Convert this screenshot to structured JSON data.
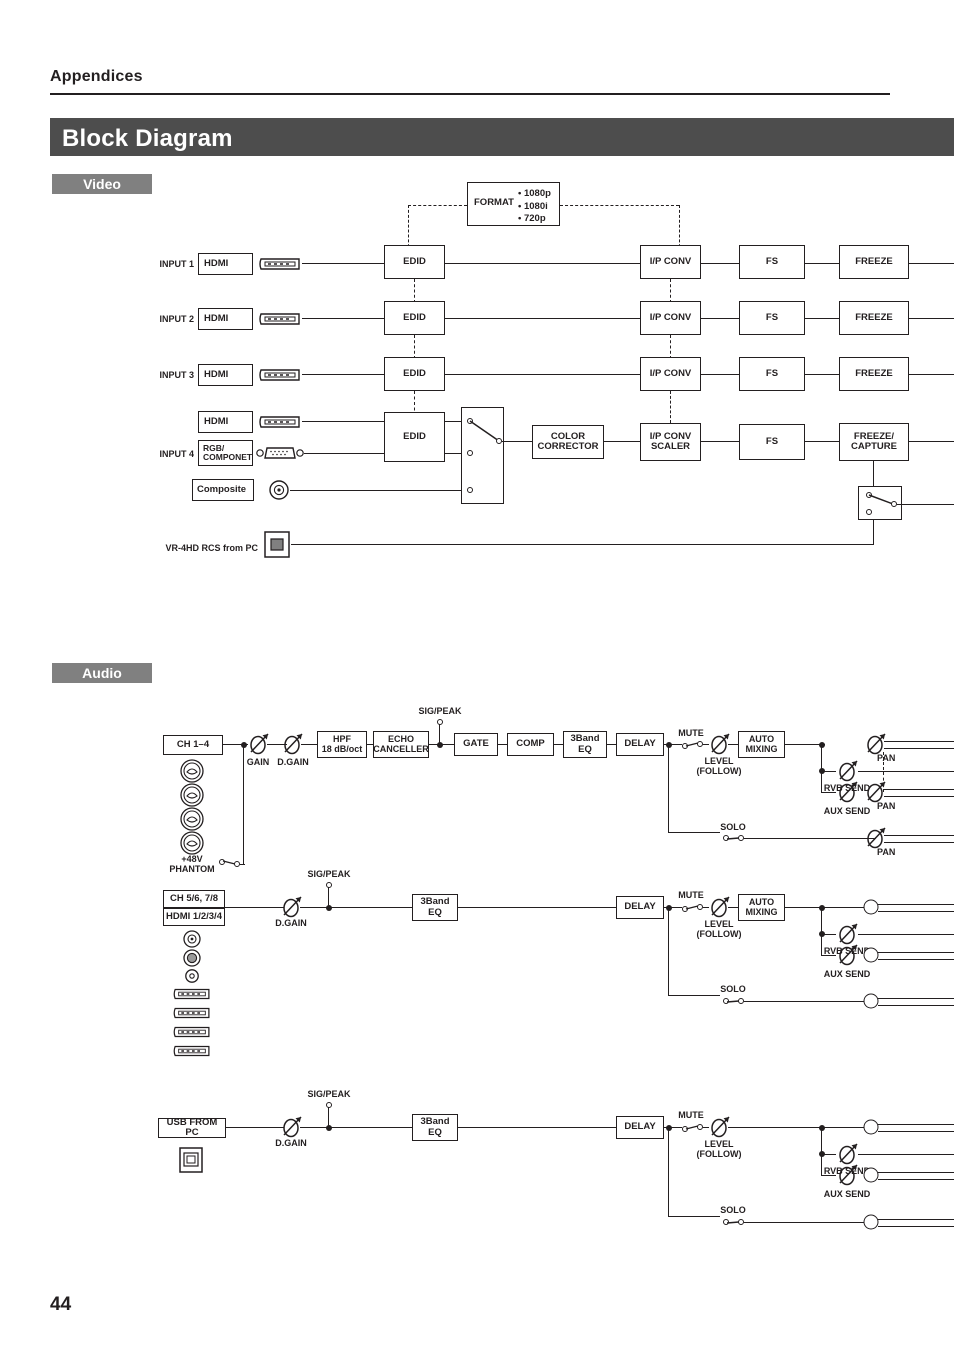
{
  "header": {
    "section": "Appendices",
    "title": "Block Diagram",
    "page_number": "44"
  },
  "sections": {
    "video_label": "Video",
    "audio_label": "Audio"
  },
  "video": {
    "format_box": {
      "label": "FORMAT",
      "options": [
        "1080p",
        "1080i",
        "720p"
      ]
    },
    "inputs": [
      {
        "name": "INPUT 1",
        "jacks": [
          {
            "label": "HDMI",
            "icon": "hdmi-connector-icon"
          }
        ]
      },
      {
        "name": "INPUT 2",
        "jacks": [
          {
            "label": "HDMI",
            "icon": "hdmi-connector-icon"
          }
        ]
      },
      {
        "name": "INPUT 3",
        "jacks": [
          {
            "label": "HDMI",
            "icon": "hdmi-connector-icon"
          }
        ]
      },
      {
        "name": "INPUT 4",
        "jacks": [
          {
            "label": "HDMI",
            "icon": "hdmi-connector-icon"
          },
          {
            "label": "RGB/\nCOMPONET",
            "icon": "dsub-connector-icon"
          },
          {
            "label": "Composite",
            "icon": "rca-connector-icon"
          }
        ]
      }
    ],
    "usb_source": {
      "label": "VR-4HD RCS from PC",
      "icon": "usb-b-connector-icon"
    },
    "edid_label": "EDID",
    "ip_conv_label": "I/P CONV",
    "ip_conv_scaler_label": "I/P CONV\nSCALER",
    "color_corrector_label": "COLOR\nCORRECTOR",
    "fs_label": "FS",
    "freeze_label": "FREEZE",
    "freeze_capture_label": "FREEZE/\nCAPTURE"
  },
  "audio": {
    "strips": [
      {
        "id": "ch1-4",
        "source_labels": [
          "CH 1–4"
        ],
        "jack_icons": [
          "xlr-combo-jack-icon",
          "xlr-combo-jack-icon",
          "xlr-combo-jack-icon",
          "xlr-combo-jack-icon"
        ],
        "phantom_label": "+48V\nPHANTOM",
        "gain_label": "GAIN",
        "dgain_label": "D.GAIN",
        "sigpeak_label": "SIG/PEAK",
        "blocks": [
          "HPF\n18 dB/oct",
          "ECHO\nCANCELLER",
          "GATE",
          "COMP",
          "3Band\nEQ",
          "DELAY"
        ],
        "mute_label": "MUTE",
        "level_label": "LEVEL\n(FOLLOW)",
        "auto_mixing_label": "AUTO\nMIXING",
        "solo_label": "SOLO",
        "rvb_send_label": "RVB SEND",
        "aux_send_label": "AUX SEND",
        "pan_labels": [
          "PAN",
          "PAN",
          "PAN"
        ]
      },
      {
        "id": "ch56-78-hdmi",
        "source_labels": [
          "CH 5/6, 7/8",
          "HDMI 1/2/3/4"
        ],
        "jack_icons": [
          "rca-jack-icon",
          "rca-jack-icon",
          "rca-jack-icon",
          "hdmi-connector-icon",
          "hdmi-connector-icon",
          "hdmi-connector-icon",
          "hdmi-connector-icon"
        ],
        "dgain_label": "D.GAIN",
        "sigpeak_label": "SIG/PEAK",
        "blocks": [
          "3Band\nEQ",
          "DELAY"
        ],
        "mute_label": "MUTE",
        "level_label": "LEVEL\n(FOLLOW)",
        "auto_mixing_label": "AUTO\nMIXING",
        "solo_label": "SOLO",
        "rvb_send_label": "RVB SEND",
        "aux_send_label": "AUX SEND"
      },
      {
        "id": "usb-from-pc",
        "source_labels": [
          "USB FROM PC"
        ],
        "jack_icons": [
          "usb-b-connector-icon"
        ],
        "dgain_label": "D.GAIN",
        "sigpeak_label": "SIG/PEAK",
        "blocks": [
          "3Band\nEQ",
          "DELAY"
        ],
        "mute_label": "MUTE",
        "level_label": "LEVEL\n(FOLLOW)",
        "solo_label": "SOLO",
        "rvb_send_label": "RVB SEND",
        "aux_send_label": "AUX SEND"
      }
    ]
  },
  "colors": {
    "title_bar": "#4d4d4d",
    "section_label": "#808080",
    "ink": "#231f20"
  }
}
